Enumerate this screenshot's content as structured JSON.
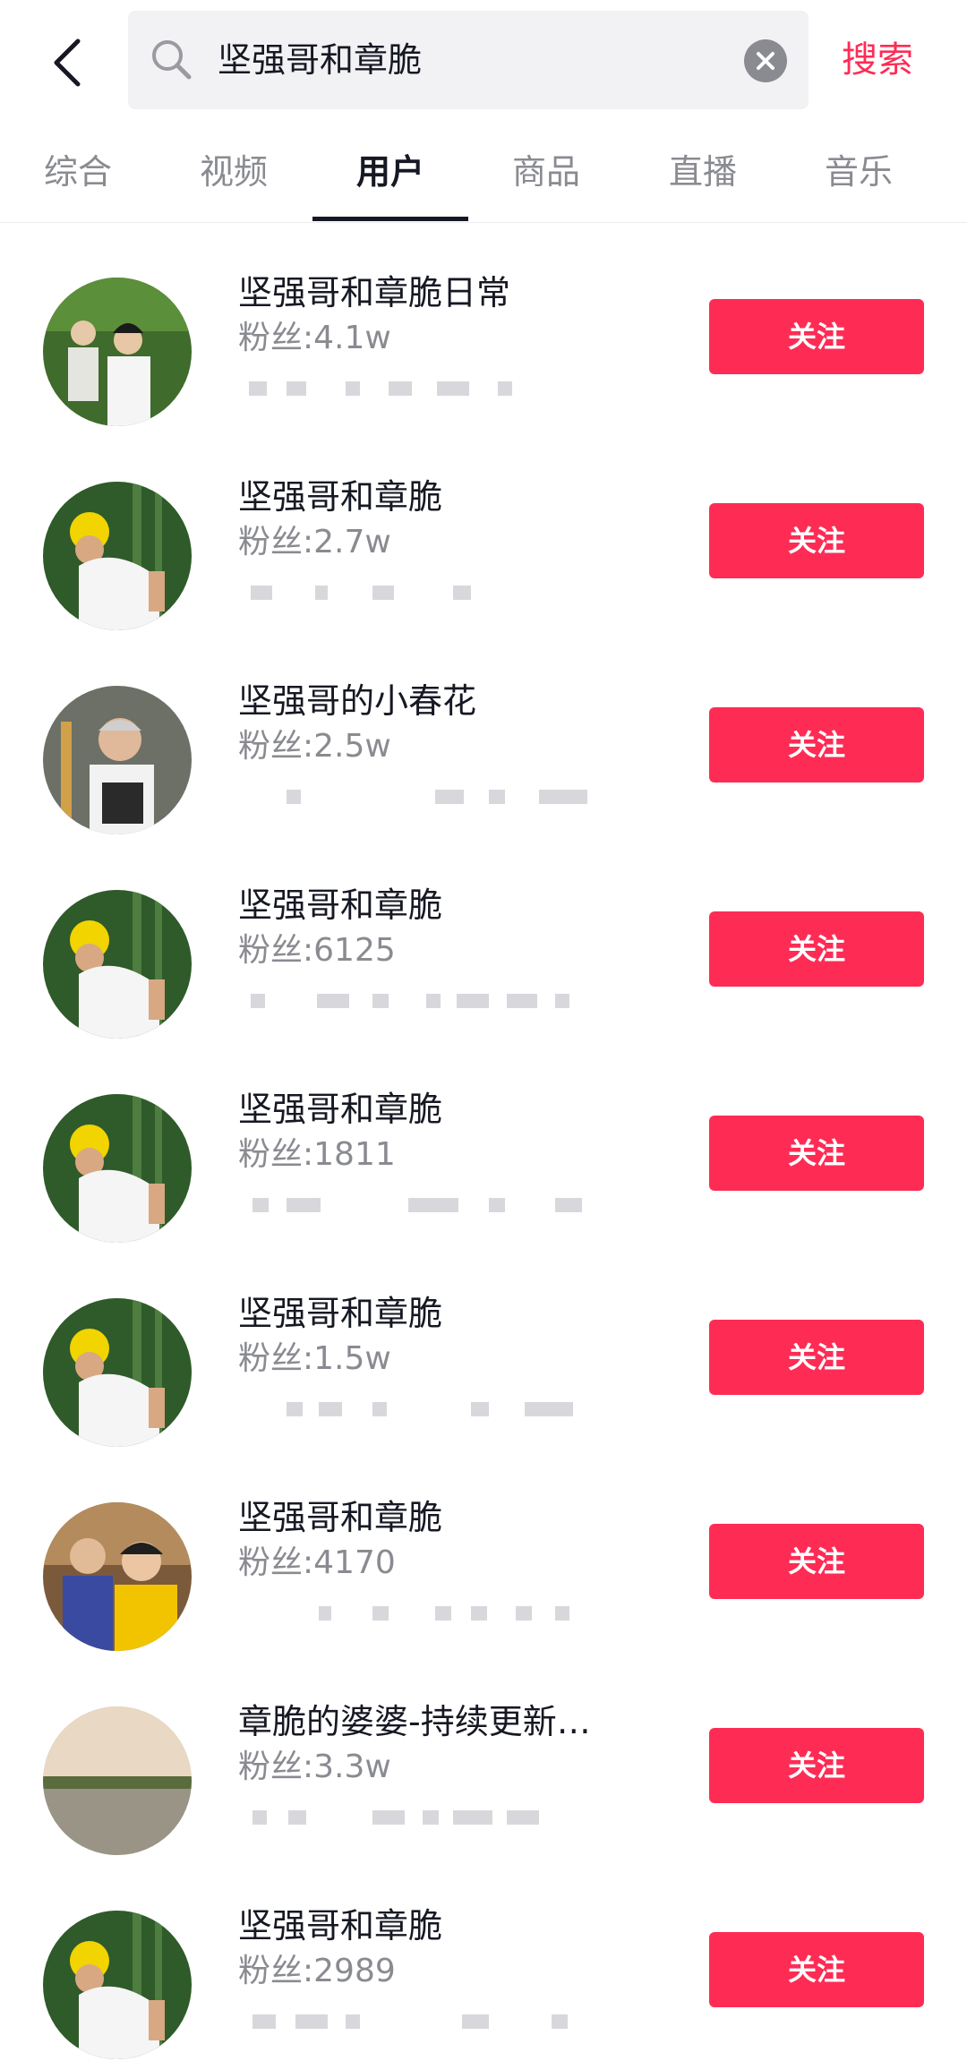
{
  "search": {
    "query": "坚强哥和章脆",
    "button_label": "搜索"
  },
  "tabs": [
    {
      "label": "综合"
    },
    {
      "label": "视频"
    },
    {
      "label": "用户"
    },
    {
      "label": "商品"
    },
    {
      "label": "直播"
    },
    {
      "label": "音乐"
    }
  ],
  "users": [
    {
      "name": "坚强哥和章脆日常",
      "fans": "粉丝:4.1w",
      "follow": "关注"
    },
    {
      "name": "坚强哥和章脆",
      "fans": "粉丝:2.7w",
      "follow": "关注"
    },
    {
      "name": "坚强哥的小春花",
      "fans": "粉丝:2.5w",
      "follow": "关注"
    },
    {
      "name": "坚强哥和章脆",
      "fans": "粉丝:6125",
      "follow": "关注"
    },
    {
      "name": "坚强哥和章脆",
      "fans": "粉丝:1811",
      "follow": "关注"
    },
    {
      "name": "坚强哥和章脆",
      "fans": "粉丝:1.5w",
      "follow": "关注"
    },
    {
      "name": "坚强哥和章脆",
      "fans": "粉丝:4170",
      "follow": "关注"
    },
    {
      "name": "章脆的婆婆-持续更新…",
      "fans": "粉丝:3.3w",
      "follow": "关注"
    },
    {
      "name": "坚强哥和章脆",
      "fans": "粉丝:2989",
      "follow": "关注"
    }
  ]
}
